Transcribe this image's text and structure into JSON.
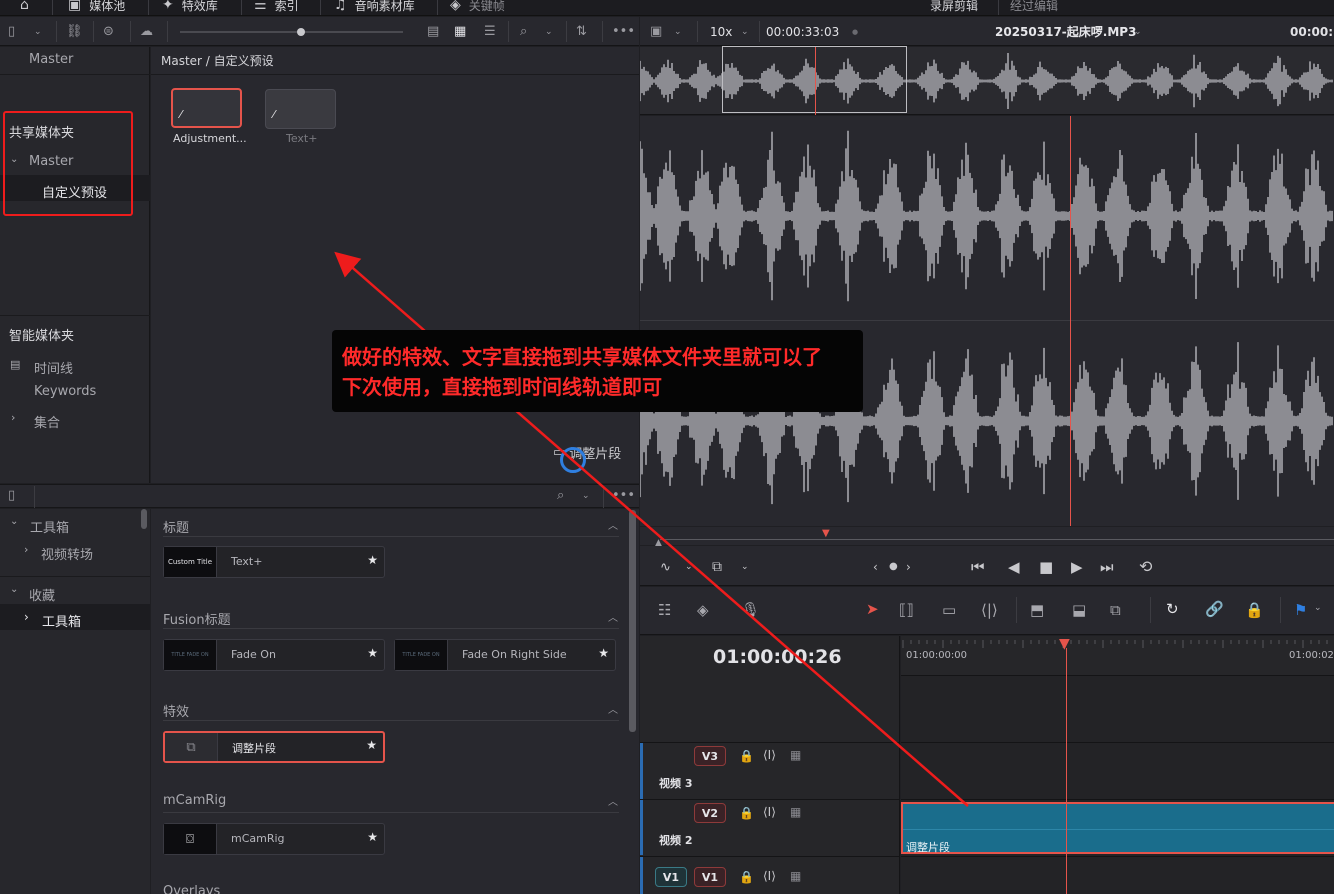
{
  "top_tabs": [
    {
      "label": "媒体池",
      "icon": "image-icon"
    },
    {
      "label": "特效库",
      "icon": "magic-wand-icon"
    },
    {
      "label": "索引",
      "icon": "list-icon"
    },
    {
      "label": "音响素材库",
      "icon": "music-note-icon"
    },
    {
      "label": "关键帧",
      "icon": "keyframe-icon"
    }
  ],
  "top_right": {
    "title": "录屏剪辑",
    "subtitle": "经过编辑"
  },
  "media_pool": {
    "master_label": "Master",
    "breadcrumb": "Master / 自定义预设",
    "shared_bins": {
      "title": "共享媒体夹",
      "master": "Master",
      "custom_preset": "自定义预设"
    },
    "smart_bins": {
      "title": "智能媒体夹",
      "timeline": "时间线",
      "keywords": "Keywords",
      "collections": "集合"
    },
    "clips": [
      {
        "label": "Adjustment...",
        "selected": true
      },
      {
        "label": "Text+",
        "selected": false
      }
    ],
    "drag_label": "调整片段"
  },
  "effects": {
    "tree": {
      "toolbox": "工具箱",
      "video_transitions": "视频转场",
      "favorites": "收藏",
      "fav_toolbox": "工具箱"
    },
    "categories": [
      {
        "name": "标题",
        "items": [
          {
            "thumb": "Custom Title",
            "name": "Text+"
          }
        ]
      },
      {
        "name": "Fusion标题",
        "items": [
          {
            "thumb": "TITLE FADE ON",
            "name": "Fade On"
          },
          {
            "thumb": "TITLE FADE ON",
            "name": "Fade On Right Side"
          }
        ]
      },
      {
        "name": "特效",
        "items": [
          {
            "thumb": "",
            "name": "调整片段"
          }
        ]
      },
      {
        "name": "mCamRig",
        "items": [
          {
            "thumb": "",
            "name": "mCamRig"
          }
        ]
      },
      {
        "name": "Overlays",
        "items": []
      }
    ],
    "star": "★"
  },
  "viewer": {
    "zoom": "10x",
    "timecode": "00:00:33:03",
    "clip_name": "20250317-起床啰.MP3",
    "timecode_right": "00:00:"
  },
  "timeline": {
    "timecode": "01:00:00:26",
    "ruler": [
      "01:00:00:00",
      "01:00:02:"
    ],
    "tracks": [
      {
        "badge": "V3",
        "name": "视频 3"
      },
      {
        "badge": "V2",
        "name": "视频 2"
      },
      {
        "badge": "V1",
        "badge_src": "V1"
      }
    ],
    "clip_label": "调整片段"
  },
  "annotation": {
    "text": "做好的特效、文字直接拖到共享媒体文件夹里就可以了\n下次使用，直接拖到时间线轨道即可"
  },
  "colors": {
    "accent_red": "#e5544b",
    "clip_teal": "#1a6d8c",
    "annotation_red": "#ff2a2a"
  }
}
